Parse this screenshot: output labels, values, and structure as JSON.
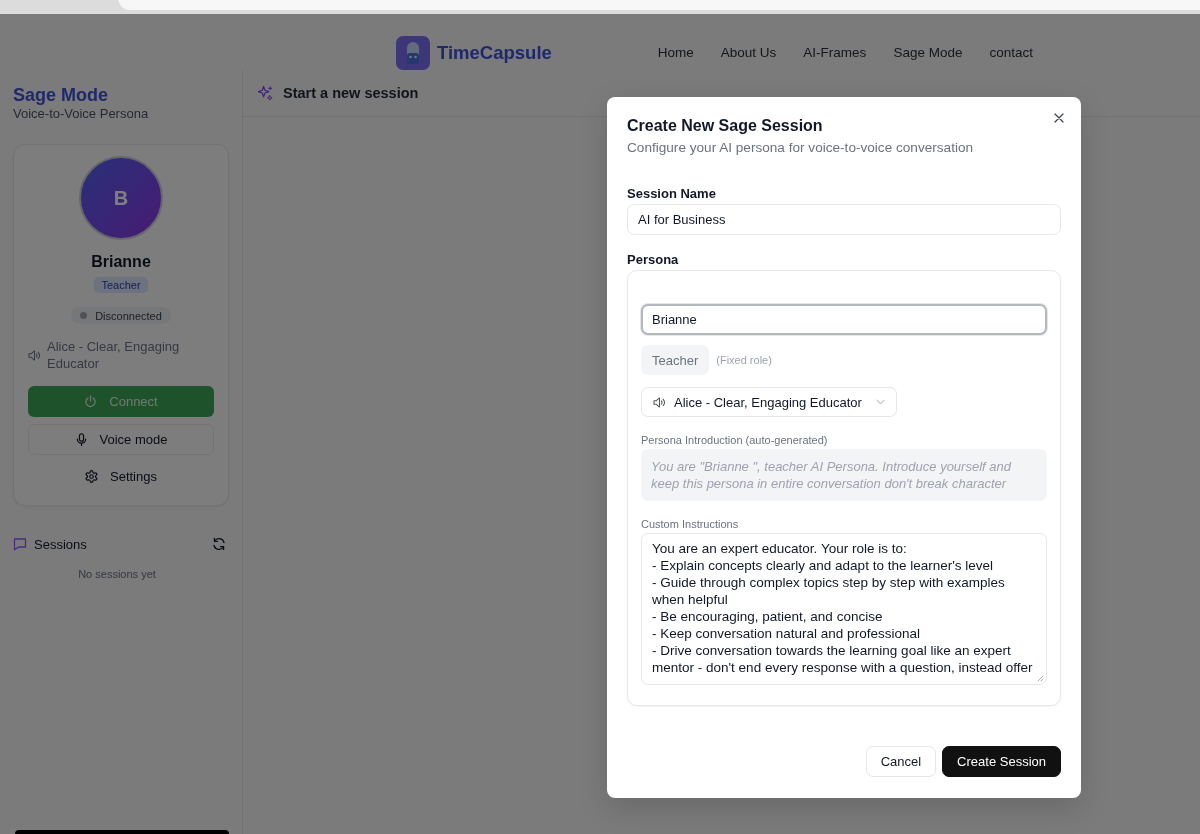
{
  "header": {
    "logo": "TimeCapsule",
    "nav": [
      {
        "label": "Home"
      },
      {
        "label": "About Us"
      },
      {
        "label": "AI-Frames"
      },
      {
        "label": "Sage Mode"
      },
      {
        "label": "contact"
      }
    ]
  },
  "sidebar": {
    "title": "Sage Mode",
    "subtitle": "Voice-to-Voice Persona",
    "persona": {
      "initial": "B",
      "name": "Brianne",
      "role": "Teacher",
      "status": {
        "label": "Disconnected",
        "connected": false
      },
      "voice": "Alice - Clear, Engaging Educator",
      "actions": [
        {
          "label": "Connect",
          "kind": "primary"
        },
        {
          "label": "Voice mode",
          "kind": "outline"
        },
        {
          "label": "Settings",
          "kind": "plain"
        }
      ]
    },
    "sessions": {
      "title": "Sessions",
      "empty_text": "No sessions yet"
    }
  },
  "main": {
    "title": "Start a new session"
  },
  "dialog": {
    "title": "Create New Sage Session",
    "subtitle": "Configure your AI persona for voice-to-voice conversation",
    "session_name": {
      "label": "Session Name",
      "value": "AI for Business"
    },
    "persona": {
      "label": "Persona",
      "name_field": {
        "value": "Brianne",
        "focused": true
      },
      "role": "Teacher",
      "role_note": "(Fixed role)",
      "voice": "Alice - Clear, Engaging Educator",
      "intro": {
        "label": "Persona Introduction (auto-generated)",
        "text": "You are \"Brianne \", teacher AI Persona. Introduce yourself and keep this persona in entire conversation don't break character"
      },
      "custom_instructions": {
        "label": "Custom Instructions",
        "value": "You are an expert educator. Your role is to:\n- Explain concepts clearly and adapt to the learner's level\n- Guide through complex topics step by step with examples when helpful\n- Be encouraging, patient, and concise\n- Keep conversation natural and professional\n- Drive conversation towards the learning goal like an expert mentor - don't end every response with a question, instead offer"
      }
    },
    "buttons": [
      {
        "label": "Cancel",
        "kind": "secondary"
      },
      {
        "label": "Create Session",
        "kind": "primary"
      }
    ]
  }
}
